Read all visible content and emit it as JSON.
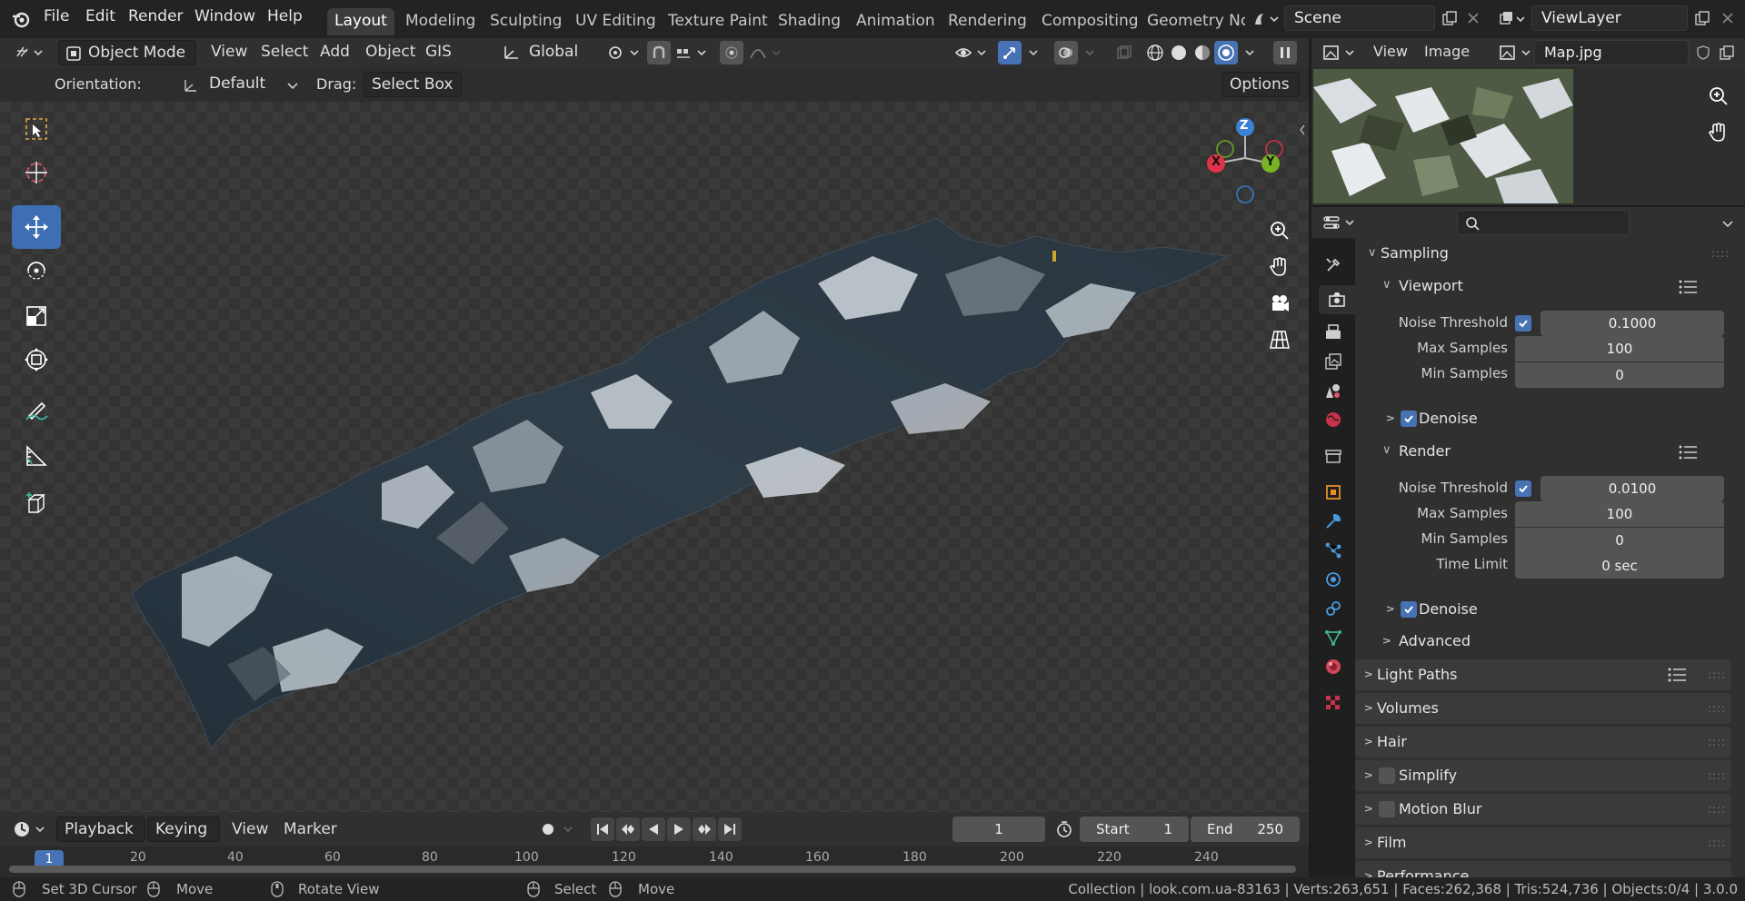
{
  "menu": {
    "file": "File",
    "edit": "Edit",
    "render": "Render",
    "window": "Window",
    "help": "Help"
  },
  "workspaces": [
    "Layout",
    "Modeling",
    "Sculpting",
    "UV Editing",
    "Texture Paint",
    "Shading",
    "Animation",
    "Rendering",
    "Compositing",
    "Geometry Nc"
  ],
  "scene": {
    "name": "Scene"
  },
  "view_layer": {
    "name": "ViewLayer"
  },
  "viewport_header": {
    "mode": "Object Mode",
    "view": "View",
    "select": "Select",
    "add": "Add",
    "object": "Object",
    "gis": "GIS",
    "transform_orientation": "Global"
  },
  "tool_settings": {
    "orientation_label": "Orientation:",
    "orientation_value": "Default",
    "drag_label": "Drag:",
    "drag_value": "Select Box",
    "options": "Options"
  },
  "gizmo": {
    "x": "X",
    "y": "Y",
    "z": "Z"
  },
  "image_editor": {
    "view": "View",
    "image": "Image",
    "image_name": "Map.jpg"
  },
  "properties": {
    "sampling": "Sampling",
    "viewport": {
      "title": "Viewport",
      "noise_threshold_label": "Noise Threshold",
      "noise_threshold": "0.1000",
      "max_samples_label": "Max Samples",
      "max_samples": "100",
      "min_samples_label": "Min Samples",
      "min_samples": "0",
      "denoise": "Denoise"
    },
    "render": {
      "title": "Render",
      "noise_threshold_label": "Noise Threshold",
      "noise_threshold": "0.0100",
      "max_samples_label": "Max Samples",
      "max_samples": "100",
      "min_samples_label": "Min Samples",
      "min_samples": "0",
      "time_limit_label": "Time Limit",
      "time_limit": "0 sec",
      "denoise": "Denoise"
    },
    "advanced": "Advanced",
    "panels": [
      "Light Paths",
      "Volumes",
      "Hair",
      "Simplify",
      "Motion Blur",
      "Film",
      "Performance"
    ]
  },
  "timeline": {
    "playback": "Playback",
    "keying": "Keying",
    "view": "View",
    "marker": "Marker",
    "current_frame": "1",
    "start_label": "Start",
    "start": "1",
    "end_label": "End",
    "end": "250",
    "ruler": [
      "1",
      "20",
      "40",
      "60",
      "80",
      "100",
      "120",
      "140",
      "160",
      "180",
      "200",
      "220",
      "240"
    ]
  },
  "status": {
    "set_cursor": "Set 3D Cursor",
    "move": "Move",
    "rotate": "Rotate View",
    "select": "Select",
    "move2": "Move",
    "stats": "Collection | look.com.ua-83163 | Verts:263,651 | Faces:262,368 | Tris:524,736 | Objects:0/4 | 3.0.0"
  },
  "colors": {
    "accent": "#4772b3",
    "x_axis": "#e0334a",
    "y_axis": "#79b323",
    "z_axis": "#3b82d6"
  }
}
